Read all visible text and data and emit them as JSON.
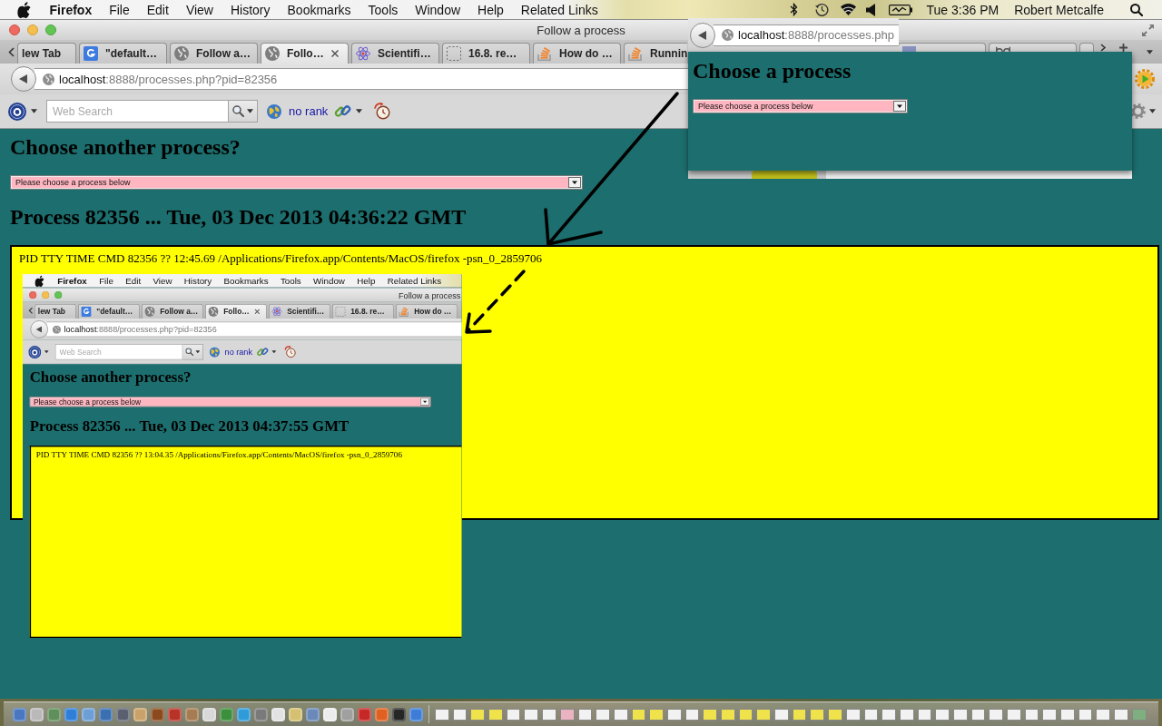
{
  "menu_bar": {
    "app_name": "Firefox",
    "menus": [
      "File",
      "Edit",
      "View",
      "History",
      "Bookmarks",
      "Tools",
      "Window",
      "Help",
      "Related Links"
    ],
    "clock": "Tue 3:36 PM",
    "user": "Robert Metcalfe"
  },
  "browser": {
    "title": "Follow a process",
    "tabs": [
      {
        "label": "lew Tab",
        "selected": false
      },
      {
        "label": "\"default…",
        "selected": false
      },
      {
        "label": "Follow a…",
        "selected": false
      },
      {
        "label": "Follo…",
        "selected": true
      },
      {
        "label": "Scientifi…",
        "selected": false
      },
      {
        "label": "16.8. re…",
        "selected": false
      },
      {
        "label": "How do …",
        "selected": false
      },
      {
        "label": "Runnin",
        "selected": false
      }
    ],
    "url": {
      "host": "localhost",
      "path": ":8888/processes.php?pid=82356"
    },
    "search": {
      "placeholder": "Web Search"
    },
    "rank": "no rank"
  },
  "page": {
    "heading": "Choose another process?",
    "select": {
      "value": "Please choose a process below"
    },
    "process_heading": "Process 82356 ... Tue, 03 Dec 2013 04:36:22 GMT",
    "ps_output": "PID TTY TIME CMD 82356 ?? 12:45.69 /Applications/Firefox.app/Contents/MacOS/firefox -psn_0_2859706",
    "embedded_screenshot": {
      "menu_bar": {
        "app_name": "Firefox",
        "menus": [
          "File",
          "Edit",
          "View",
          "History",
          "Bookmarks",
          "Tools",
          "Window",
          "Help",
          "Related Links"
        ]
      },
      "browser": {
        "title": "Follow a process",
        "tabs": [
          {
            "label": "lew Tab",
            "selected": false
          },
          {
            "label": "\"default…",
            "selected": false
          },
          {
            "label": "Follow a…",
            "selected": false
          },
          {
            "label": "Follo…",
            "selected": true
          },
          {
            "label": "Scientifi…",
            "selected": false
          },
          {
            "label": "16.8. re…",
            "selected": false
          },
          {
            "label": "How do …",
            "selected": false
          }
        ],
        "url": {
          "host": "localhost",
          "path": ":8888/processes.php?pid=82356"
        },
        "search": {
          "placeholder": "Web Search"
        },
        "rank": "no rank"
      },
      "page": {
        "heading": "Choose another process?",
        "select": {
          "value": "Please choose a process below"
        },
        "process_heading": "Process 82356 ... Tue, 03 Dec 2013 04:37:55 GMT",
        "ps_output": "PID TTY TIME CMD 82356 ?? 13:04.35 /Applications/Firefox.app/Contents/MacOS/firefox -psn_0_2859706"
      }
    }
  },
  "popup_window": {
    "url": {
      "host": "localhost",
      "path": ":8888/processes.php"
    },
    "heading": "Choose a process",
    "select": {
      "value": "Please choose a process below"
    }
  }
}
